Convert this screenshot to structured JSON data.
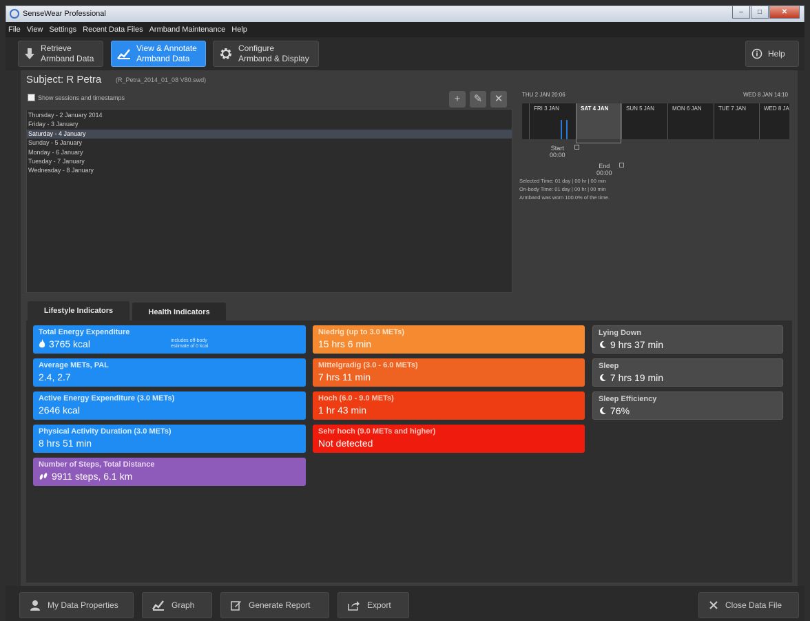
{
  "window": {
    "title": "SenseWear Professional",
    "controls": {
      "minimize": "–",
      "maximize": "□",
      "close": "✕"
    }
  },
  "menu": [
    "File",
    "View",
    "Settings",
    "Recent Data Files",
    "Armband Maintenance",
    "Help"
  ],
  "toolbar": {
    "retrieve_line1": "Retrieve",
    "retrieve_line2": "Armband Data",
    "view_line1": "View & Annotate",
    "view_line2": "Armband Data",
    "configure_line1": "Configure",
    "configure_line2": "Armband & Display",
    "help_label": "Help"
  },
  "subject": {
    "title": "Subject: R Petra",
    "file": "(R_Petra_2014_01_08 V80.swd)",
    "show_sessions_label": "Show sessions and timestamps"
  },
  "list_buttons": {
    "add": "+",
    "edit": "✎",
    "delete": "✕"
  },
  "days": [
    "Thursday - 2 January 2014",
    "Friday - 3 January",
    "Saturday - 4 January",
    "Sunday - 5 January",
    "Monday - 6 January",
    "Tuesday - 7 January",
    "Wednesday - 8 January"
  ],
  "selected_day_index": 2,
  "timeline": {
    "start_label": "THU 2 JAN 20:06",
    "end_label": "WED 8 JAN 14:10",
    "days": [
      "FRI 3 JAN",
      "SAT 4 JAN",
      "SUN 5 JAN",
      "MON 6 JAN",
      "TUE 7 JAN",
      "WED 8 JAN"
    ],
    "selected_day": "SAT 4 JAN",
    "start_marker_label": "Start",
    "start_marker_time": "00:00",
    "end_marker_label": "End",
    "end_marker_time": "00:00",
    "selected_time": "Selected Time:  01 day | 00 hr | 00 min",
    "onbody_time": "On-body Time:   01 day | 00 hr | 00 min",
    "worn_note": "Armband was worn 100.0% of the time."
  },
  "tabs": {
    "lifestyle": "Lifestyle Indicators",
    "health": "Health Indicators"
  },
  "cards": {
    "tee": {
      "title": "Total Energy Expenditure",
      "value": "3765 kcal",
      "note_line1": "includes off-body",
      "note_line2": "estimate of 0 kcal"
    },
    "mets": {
      "title": "Average METs, PAL",
      "value": "2.4, 2.7"
    },
    "aee": {
      "title": "Active Energy Expenditure (3.0 METs)",
      "value": "2646 kcal"
    },
    "pad": {
      "title": "Physical Activity Duration (3.0 METs)",
      "value": "8 hrs 51 min"
    },
    "steps": {
      "title": "Number of Steps, Total Distance",
      "value": "9911 steps, 6.1 km"
    },
    "niedrig": {
      "title": "Niedrig  (up to 3.0 METs)",
      "value": "15 hrs 6 min"
    },
    "mittel": {
      "title": "Mittelgradig  (3.0 - 6.0 METs)",
      "value": "7 hrs 11 min"
    },
    "hoch": {
      "title": "Hoch  (6.0 - 9.0 METs)",
      "value": "1 hr 43 min"
    },
    "sehrhoch": {
      "title": "Sehr hoch  (9.0 METs and higher)",
      "value": "Not detected"
    },
    "lying": {
      "title": "Lying Down",
      "value": "9 hrs 37 min"
    },
    "sleep": {
      "title": "Sleep",
      "value": "7 hrs 19 min"
    },
    "efficiency": {
      "title": "Sleep Efficiency",
      "value": "76%"
    }
  },
  "bottom": {
    "props": "My Data Properties",
    "graph": "Graph",
    "report": "Generate Report",
    "export": "Export",
    "close": "Close Data File"
  },
  "icons": {
    "flame": "flame-icon",
    "moon": "moon-icon",
    "steps": "footsteps-icon",
    "info": "info-icon"
  },
  "colors": {
    "blue": "#1f8cf4",
    "purple": "#8f5bba",
    "orange1": "#f58a31",
    "orange2": "#ee6322",
    "orange3": "#ee3d12",
    "red": "#ef1c0e",
    "selected_blue": "#2c8bef"
  }
}
